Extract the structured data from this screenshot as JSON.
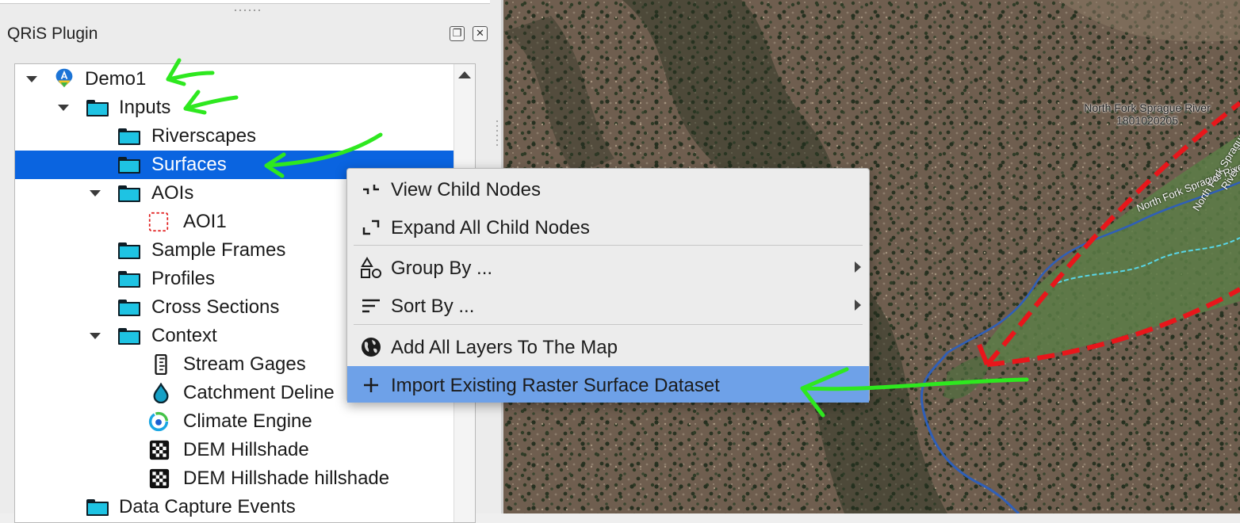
{
  "panel": {
    "title": "QRiS Plugin",
    "float_icon": "float-window-icon",
    "close_icon": "close-icon"
  },
  "tree": {
    "items": [
      {
        "label": "Demo1",
        "icon": "project-icon",
        "expanded": true
      },
      {
        "label": "Inputs",
        "icon": "folder-icon",
        "expanded": true
      },
      {
        "label": "Riverscapes",
        "icon": "folder-icon"
      },
      {
        "label": "Surfaces",
        "icon": "folder-icon",
        "selected": true
      },
      {
        "label": "AOIs",
        "icon": "folder-icon",
        "expanded": true
      },
      {
        "label": "AOI1",
        "icon": "aoi-icon"
      },
      {
        "label": "Sample Frames",
        "icon": "folder-icon"
      },
      {
        "label": "Profiles",
        "icon": "folder-icon"
      },
      {
        "label": "Cross Sections",
        "icon": "folder-icon"
      },
      {
        "label": "Context",
        "icon": "folder-icon",
        "expanded": true
      },
      {
        "label": "Stream Gages",
        "icon": "stream-gage-icon"
      },
      {
        "label": "Catchment Deline",
        "icon": "water-drop-icon"
      },
      {
        "label": "Climate Engine",
        "icon": "climate-engine-icon"
      },
      {
        "label": "DEM Hillshade",
        "icon": "raster-icon"
      },
      {
        "label": "DEM Hillshade hillshade",
        "icon": "raster-icon"
      },
      {
        "label": "Data Capture Events",
        "icon": "folder-icon"
      }
    ]
  },
  "context_menu": {
    "items": [
      {
        "label": "View Child Nodes",
        "icon": "collapse-icon"
      },
      {
        "label": "Expand All Child Nodes",
        "icon": "expand-icon"
      },
      {
        "label": "Group By ...",
        "icon": "shapes-icon",
        "submenu": true
      },
      {
        "label": "Sort By ...",
        "icon": "sort-icon",
        "submenu": true
      },
      {
        "label": "Add All Layers To The Map",
        "icon": "globe-icon"
      },
      {
        "label": "Import Existing Raster Surface Dataset",
        "icon": "plus-icon",
        "highlighted": true
      }
    ]
  },
  "map": {
    "watershed_label": "North Fork Sprague River",
    "huc_code": "1801020205",
    "river_label": "North Fork Sprague River",
    "colors": {
      "aoi_boundary": "#e8161b",
      "river": "#2f5fb8",
      "side_channel": "#58d6e8",
      "annotation": "#2ee81f"
    }
  }
}
